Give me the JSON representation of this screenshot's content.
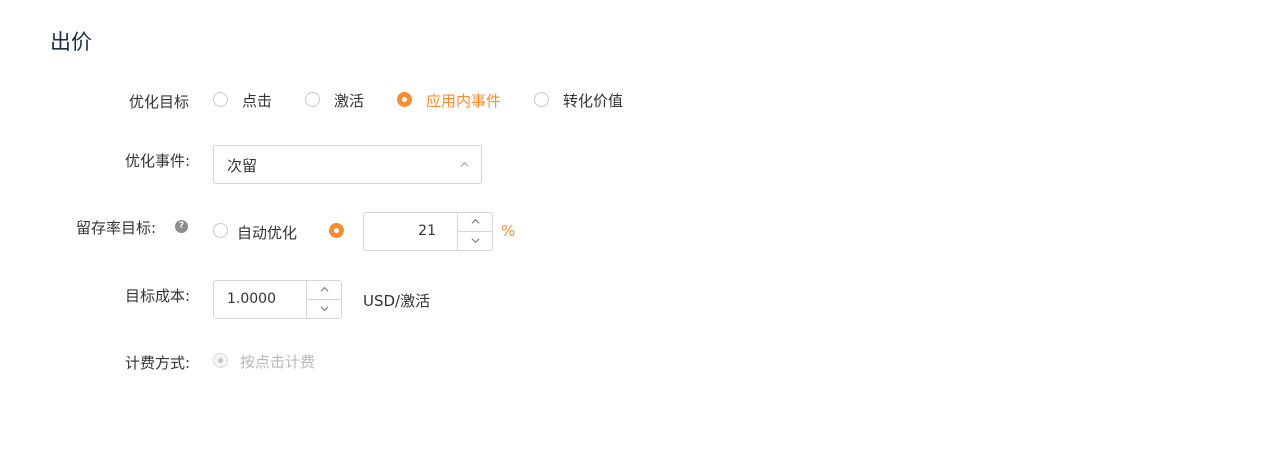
{
  "section": {
    "title": "出价"
  },
  "optimization_goal": {
    "label": "优化目标",
    "options": [
      {
        "label": "点击",
        "selected": false
      },
      {
        "label": "激活",
        "selected": false
      },
      {
        "label": "应用内事件",
        "selected": true
      },
      {
        "label": "转化价值",
        "selected": false
      }
    ]
  },
  "optimization_event": {
    "label": "优化事件:",
    "selected": "次留",
    "icon": "chevron-up-icon"
  },
  "retention_target": {
    "label": "留存率目标:",
    "help_icon": "question-circle-icon",
    "help_glyph": "?",
    "auto_option": "自动优化",
    "value": "21",
    "unit": "%",
    "accent": "#fa8c35"
  },
  "target_cost": {
    "label": "目标成本:",
    "value": "1.0000",
    "unit": "USD/激活"
  },
  "billing": {
    "label": "计费方式:",
    "option": "按点击计费"
  }
}
